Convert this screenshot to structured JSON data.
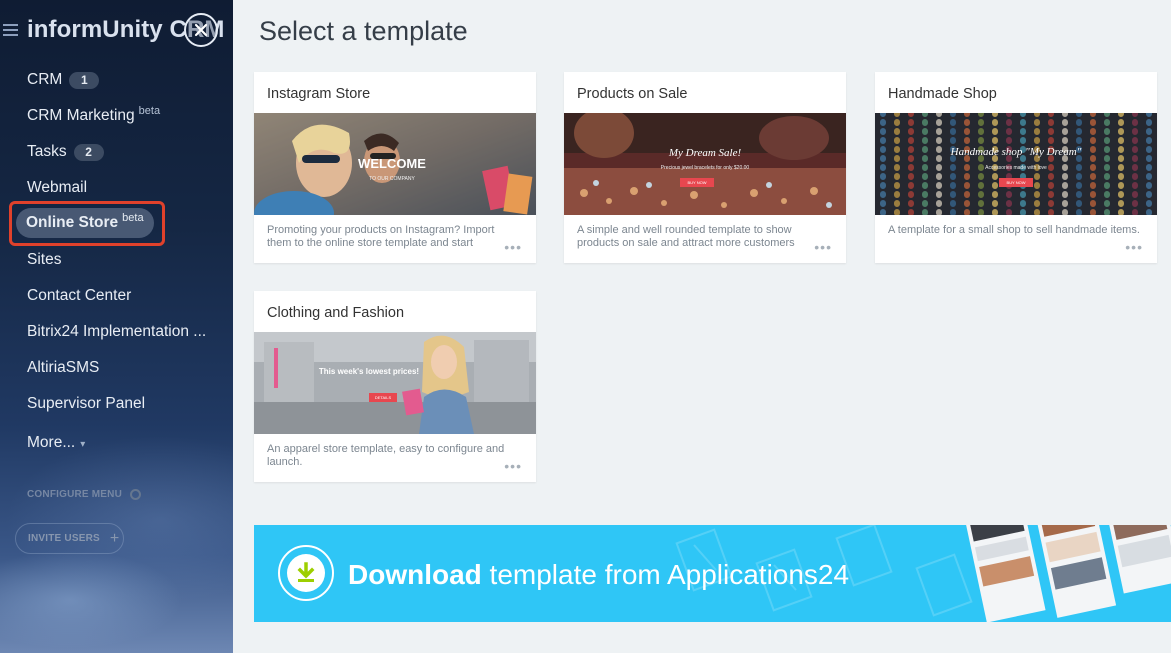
{
  "sidebar": {
    "brand": "informUnity CRM",
    "items": [
      {
        "label": "CRM",
        "count": "1"
      },
      {
        "label": "CRM Marketing",
        "beta": "beta"
      },
      {
        "label": "Tasks",
        "count": "2"
      },
      {
        "label": "Webmail"
      },
      {
        "label": "Online Store",
        "beta": "beta"
      },
      {
        "label": "Sites"
      },
      {
        "label": "Contact Center"
      },
      {
        "label": "Bitrix24 Implementation ..."
      },
      {
        "label": "AltiriaSMS"
      },
      {
        "label": "Supervisor Panel"
      },
      {
        "label": "More..."
      }
    ],
    "configure_menu": "CONFIGURE MENU",
    "invite_users": "INVITE USERS"
  },
  "main": {
    "title": "Select a template",
    "templates": [
      {
        "title": "Instagram Store",
        "description": "Promoting your products on Instagram? Import them to the online store template and start",
        "thumb_heading": "WELCOME",
        "thumb_sub": "TO OUR COMPANY"
      },
      {
        "title": "Products on Sale",
        "description": "A simple and well rounded template to show products on sale and attract more customers",
        "thumb_heading": "My Dream Sale!",
        "thumb_sub": "Precious jewel bracelets for only $20.00",
        "thumb_button": "BUY NOW"
      },
      {
        "title": "Handmade Shop",
        "description": "A template for a small shop to sell handmade items.",
        "thumb_heading": "Handmade shop \"My Dream\"",
        "thumb_sub": "Accessories made with love",
        "thumb_button": "BUY NOW"
      },
      {
        "title": "Clothing and Fashion",
        "description": "An apparel store template, easy to configure and launch.",
        "thumb_heading": "This week's lowest prices!",
        "thumb_button": "DETAILS"
      }
    ],
    "more_dots": "•••"
  },
  "banner": {
    "bold": "Download",
    "rest": " template from Applications24"
  },
  "colors": {
    "accent_blue": "#2fc6f6",
    "highlight_red": "#e0412b",
    "sidebar_dark": "#152744",
    "download_green": "#9dcf00"
  }
}
